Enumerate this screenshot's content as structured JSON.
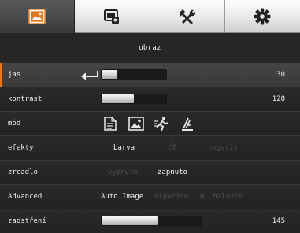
{
  "tabs": [
    {
      "icon": "image-icon",
      "active": true
    },
    {
      "icon": "camera-settings-icon",
      "active": false
    },
    {
      "icon": "tools-icon",
      "active": false
    },
    {
      "icon": "gear-icon",
      "active": false
    }
  ],
  "section_title": "obraz",
  "colors": {
    "accent": "#e07a1e",
    "background": "#222222",
    "text": "#ededed",
    "disabled_text": "#4f4f4f",
    "tab_face": "#e8e8e8"
  },
  "rows": {
    "jas": {
      "label": "jas",
      "value": "30",
      "level": 0.24,
      "selected": true
    },
    "kontrast": {
      "label": "kontrast",
      "value": "128",
      "level": 0.5
    },
    "mod": {
      "label": "mód",
      "icons": [
        "document-icon",
        "picture-icon",
        "motion-icon",
        "graph-icon"
      ]
    },
    "efekty": {
      "label": "efekty",
      "options": [
        "barva",
        "ČB",
        "negativ"
      ],
      "selected": "barva"
    },
    "zrcadlo": {
      "label": "zrcadlo",
      "options": [
        "vypnuto",
        "zapnuto"
      ],
      "selected": "zapnuto"
    },
    "advanced": {
      "label": "Advanced",
      "options": [
        "Auto Image",
        "expozice",
        "W. Balance"
      ],
      "selected": "Auto Image"
    },
    "zaostreni": {
      "label": "zaostření",
      "value": "145",
      "level": 0.57
    }
  }
}
